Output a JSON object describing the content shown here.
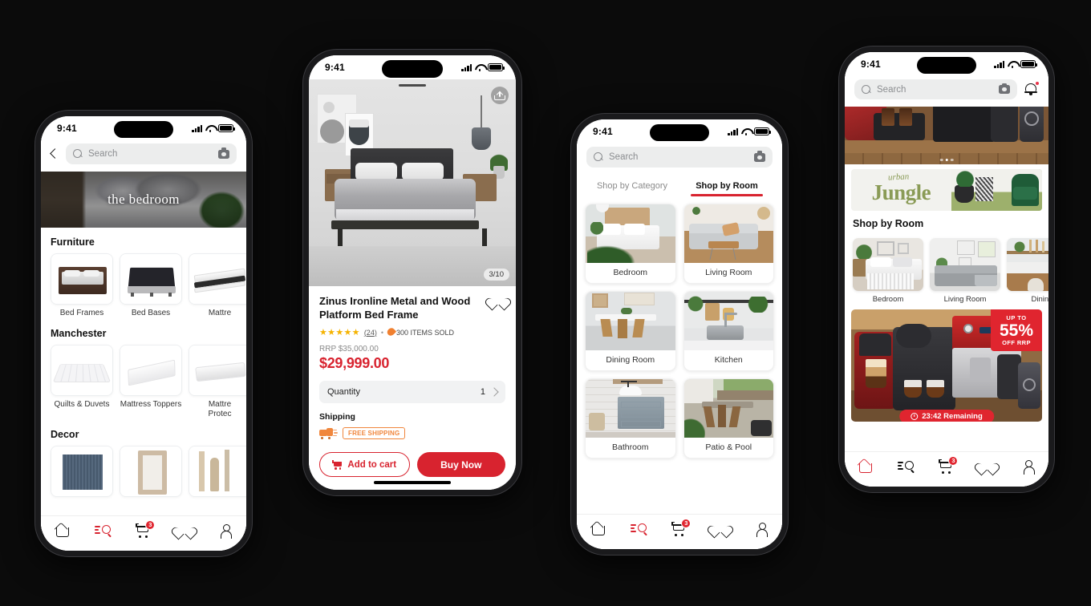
{
  "theme": {
    "background": "#0b0b0b",
    "accent_red": "#d8232f",
    "badge_red": "#e0252f",
    "star_gold": "#f5b301",
    "shipping_orange": "#f0863c",
    "jungle_green": "#8a9b56"
  },
  "status_bar": {
    "time": "9:41"
  },
  "phone1": {
    "search": {
      "placeholder": "Search",
      "camera_icon": "camera-icon",
      "back_icon": "chevron-left-icon"
    },
    "hero": {
      "label": "the bedroom"
    },
    "sections": [
      {
        "title": "Furniture",
        "items": [
          {
            "label": "Bed Frames"
          },
          {
            "label": "Bed Bases"
          },
          {
            "label": "Mattre"
          }
        ]
      },
      {
        "title": "Manchester",
        "items": [
          {
            "label": "Quilts & Duvets"
          },
          {
            "label": "Mattress Toppers"
          },
          {
            "label": "Mattre\nProtec"
          }
        ]
      },
      {
        "title": "Decor",
        "items": [
          {
            "label": ""
          },
          {
            "label": ""
          },
          {
            "label": ""
          }
        ]
      }
    ],
    "nav": {
      "active": "search",
      "cart_badge": "3",
      "items": [
        {
          "name": "home",
          "icon": "home-icon"
        },
        {
          "name": "search",
          "icon": "search-filter-icon"
        },
        {
          "name": "cart",
          "icon": "cart-icon"
        },
        {
          "name": "wishlist",
          "icon": "heart-icon"
        },
        {
          "name": "account",
          "icon": "person-icon"
        }
      ]
    }
  },
  "phone2": {
    "gallery": {
      "page_indicator": "3/10",
      "share_icon": "share-icon"
    },
    "product": {
      "title": "Zinus Ironline Metal and Wood Platform Bed Frame",
      "wishlist_icon": "heart-outline-icon",
      "stars": "★★★★★",
      "review_count": "(24)",
      "separator": "•",
      "items_sold": "300 ITEMS SOLD",
      "rrp": "RRP $35,000.00",
      "price": "$29,999.00",
      "quantity_label": "Quantity",
      "quantity_value": "1",
      "shipping_label": "Shipping",
      "shipping_badge": "FREE SHIPPING",
      "truck_icon": "delivery-truck-icon"
    },
    "cta": {
      "add_to_cart": "Add to cart",
      "buy_now": "Buy Now"
    }
  },
  "phone3": {
    "search": {
      "placeholder": "Search",
      "camera_icon": "camera-icon"
    },
    "tabs": [
      {
        "label": "Shop by Category",
        "active": false
      },
      {
        "label": "Shop by Room",
        "active": true
      }
    ],
    "rooms": [
      {
        "label": "Bedroom"
      },
      {
        "label": "Living Room"
      },
      {
        "label": "Dining Room"
      },
      {
        "label": "Kitchen"
      },
      {
        "label": "Bathroom"
      },
      {
        "label": "Patio & Pool"
      }
    ],
    "nav": {
      "active": "search",
      "cart_badge": "3"
    }
  },
  "phone4": {
    "search": {
      "placeholder": "Search",
      "camera_icon": "camera-icon",
      "bell_icon": "notification-bell-icon"
    },
    "banner": {
      "script_word": "urban",
      "main_word": "Jungle"
    },
    "section_title": "Shop by Room",
    "rooms": [
      {
        "label": "Bedroom"
      },
      {
        "label": "Living Room"
      },
      {
        "label": "Dining"
      }
    ],
    "promo": {
      "flag_top": "UP TO",
      "flag_percent": "55%",
      "flag_bottom": "OFF RRP",
      "timer": "23:42 Remaining",
      "clock_icon": "clock-icon"
    },
    "nav": {
      "active": "home",
      "cart_badge": "3"
    }
  }
}
